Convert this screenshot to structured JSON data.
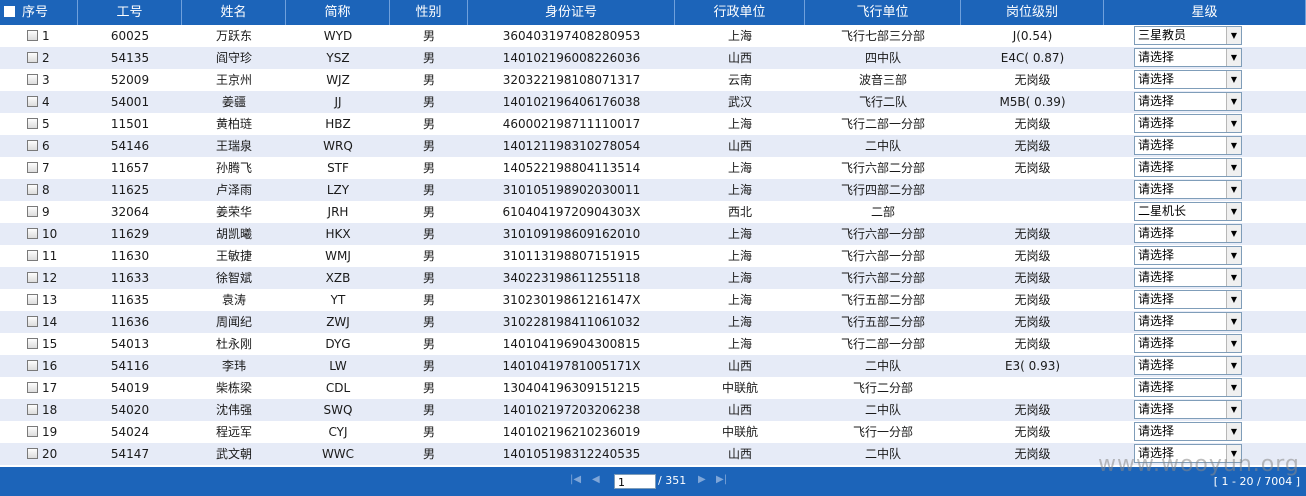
{
  "header": {
    "index": "序号",
    "emp_no": "工号",
    "name": "姓名",
    "abbr": "简称",
    "gender": "性别",
    "id_no": "身份证号",
    "admin_unit": "行政单位",
    "flight_unit": "飞行单位",
    "post_level": "岗位级别",
    "star_level": "星级"
  },
  "rows": [
    {
      "index": "1",
      "emp_no": "60025",
      "name": "万跃东",
      "abbr": "WYD",
      "gender": "男",
      "id_no": "360403197408280953",
      "admin_unit": "上海",
      "flight_unit": "飞行七部三分部",
      "post_level": "J(0.54)",
      "star": "三星教员"
    },
    {
      "index": "2",
      "emp_no": "54135",
      "name": "阎守珍",
      "abbr": "YSZ",
      "gender": "男",
      "id_no": "140102196008226036",
      "admin_unit": "山西",
      "flight_unit": "四中队",
      "post_level": "E4C( 0.87)",
      "star": "请选择"
    },
    {
      "index": "3",
      "emp_no": "52009",
      "name": "王京州",
      "abbr": "WJZ",
      "gender": "男",
      "id_no": "320322198108071317",
      "admin_unit": "云南",
      "flight_unit": "波音三部",
      "post_level": "无岗级",
      "star": "请选择"
    },
    {
      "index": "4",
      "emp_no": "54001",
      "name": "姜疆",
      "abbr": "JJ",
      "gender": "男",
      "id_no": "140102196406176038",
      "admin_unit": "武汉",
      "flight_unit": "飞行二队",
      "post_level": "M5B( 0.39)",
      "star": "请选择"
    },
    {
      "index": "5",
      "emp_no": "11501",
      "name": "黄柏琏",
      "abbr": "HBZ",
      "gender": "男",
      "id_no": "460002198711110017",
      "admin_unit": "上海",
      "flight_unit": "飞行二部一分部",
      "post_level": "无岗级",
      "star": "请选择"
    },
    {
      "index": "6",
      "emp_no": "54146",
      "name": "王瑞泉",
      "abbr": "WRQ",
      "gender": "男",
      "id_no": "140121198310278054",
      "admin_unit": "山西",
      "flight_unit": "二中队",
      "post_level": "无岗级",
      "star": "请选择"
    },
    {
      "index": "7",
      "emp_no": "11657",
      "name": "孙腾飞",
      "abbr": "STF",
      "gender": "男",
      "id_no": "140522198804113514",
      "admin_unit": "上海",
      "flight_unit": "飞行六部二分部",
      "post_level": "无岗级",
      "star": "请选择"
    },
    {
      "index": "8",
      "emp_no": "11625",
      "name": "卢泽雨",
      "abbr": "LZY",
      "gender": "男",
      "id_no": "310105198902030011",
      "admin_unit": "上海",
      "flight_unit": "飞行四部二分部",
      "post_level": "",
      "star": "请选择"
    },
    {
      "index": "9",
      "emp_no": "32064",
      "name": "姜荣华",
      "abbr": "JRH",
      "gender": "男",
      "id_no": "61040419720904303X",
      "admin_unit": "西北",
      "flight_unit": "二部",
      "post_level": "",
      "star": "二星机长"
    },
    {
      "index": "10",
      "emp_no": "11629",
      "name": "胡凯曦",
      "abbr": "HKX",
      "gender": "男",
      "id_no": "310109198609162010",
      "admin_unit": "上海",
      "flight_unit": "飞行六部一分部",
      "post_level": "无岗级",
      "star": "请选择"
    },
    {
      "index": "11",
      "emp_no": "11630",
      "name": "王敏捷",
      "abbr": "WMJ",
      "gender": "男",
      "id_no": "310113198807151915",
      "admin_unit": "上海",
      "flight_unit": "飞行六部一分部",
      "post_level": "无岗级",
      "star": "请选择"
    },
    {
      "index": "12",
      "emp_no": "11633",
      "name": "徐智斌",
      "abbr": "XZB",
      "gender": "男",
      "id_no": "340223198611255118",
      "admin_unit": "上海",
      "flight_unit": "飞行六部二分部",
      "post_level": "无岗级",
      "star": "请选择"
    },
    {
      "index": "13",
      "emp_no": "11635",
      "name": "袁涛",
      "abbr": "YT",
      "gender": "男",
      "id_no": "31023019861216147X",
      "admin_unit": "上海",
      "flight_unit": "飞行五部二分部",
      "post_level": "无岗级",
      "star": "请选择"
    },
    {
      "index": "14",
      "emp_no": "11636",
      "name": "周闻纪",
      "abbr": "ZWJ",
      "gender": "男",
      "id_no": "310228198411061032",
      "admin_unit": "上海",
      "flight_unit": "飞行五部二分部",
      "post_level": "无岗级",
      "star": "请选择"
    },
    {
      "index": "15",
      "emp_no": "54013",
      "name": "杜永刚",
      "abbr": "DYG",
      "gender": "男",
      "id_no": "140104196904300815",
      "admin_unit": "上海",
      "flight_unit": "飞行二部一分部",
      "post_level": "无岗级",
      "star": "请选择"
    },
    {
      "index": "16",
      "emp_no": "54116",
      "name": "李玮",
      "abbr": "LW",
      "gender": "男",
      "id_no": "14010419781005171X",
      "admin_unit": "山西",
      "flight_unit": "二中队",
      "post_level": "E3( 0.93)",
      "star": "请选择"
    },
    {
      "index": "17",
      "emp_no": "54019",
      "name": "柴栋梁",
      "abbr": "CDL",
      "gender": "男",
      "id_no": "130404196309151215",
      "admin_unit": "中联航",
      "flight_unit": "飞行二分部",
      "post_level": "",
      "star": "请选择"
    },
    {
      "index": "18",
      "emp_no": "54020",
      "name": "沈伟强",
      "abbr": "SWQ",
      "gender": "男",
      "id_no": "140102197203206238",
      "admin_unit": "山西",
      "flight_unit": "二中队",
      "post_level": "无岗级",
      "star": "请选择"
    },
    {
      "index": "19",
      "emp_no": "54024",
      "name": "程远军",
      "abbr": "CYJ",
      "gender": "男",
      "id_no": "140102196210236019",
      "admin_unit": "中联航",
      "flight_unit": "飞行一分部",
      "post_level": "无岗级",
      "star": "请选择"
    },
    {
      "index": "20",
      "emp_no": "54147",
      "name": "武文朝",
      "abbr": "WWC",
      "gender": "男",
      "id_no": "140105198312240535",
      "admin_unit": "山西",
      "flight_unit": "二中队",
      "post_level": "无岗级",
      "star": "请选择"
    }
  ],
  "pager": {
    "first_icon": "first-page-icon",
    "prev_icon": "prev-page-icon",
    "next_icon": "next-page-icon",
    "last_icon": "last-page-icon",
    "current_page": "1",
    "total_pages": "/ 351",
    "range_info": "[ 1 - 20 / 7004 ]"
  },
  "watermark": "www.wooyun.org",
  "colors": {
    "header_bg": "#1c64b9",
    "row_alt_bg": "#e6ebf7",
    "row_bg": "#ffffff"
  }
}
